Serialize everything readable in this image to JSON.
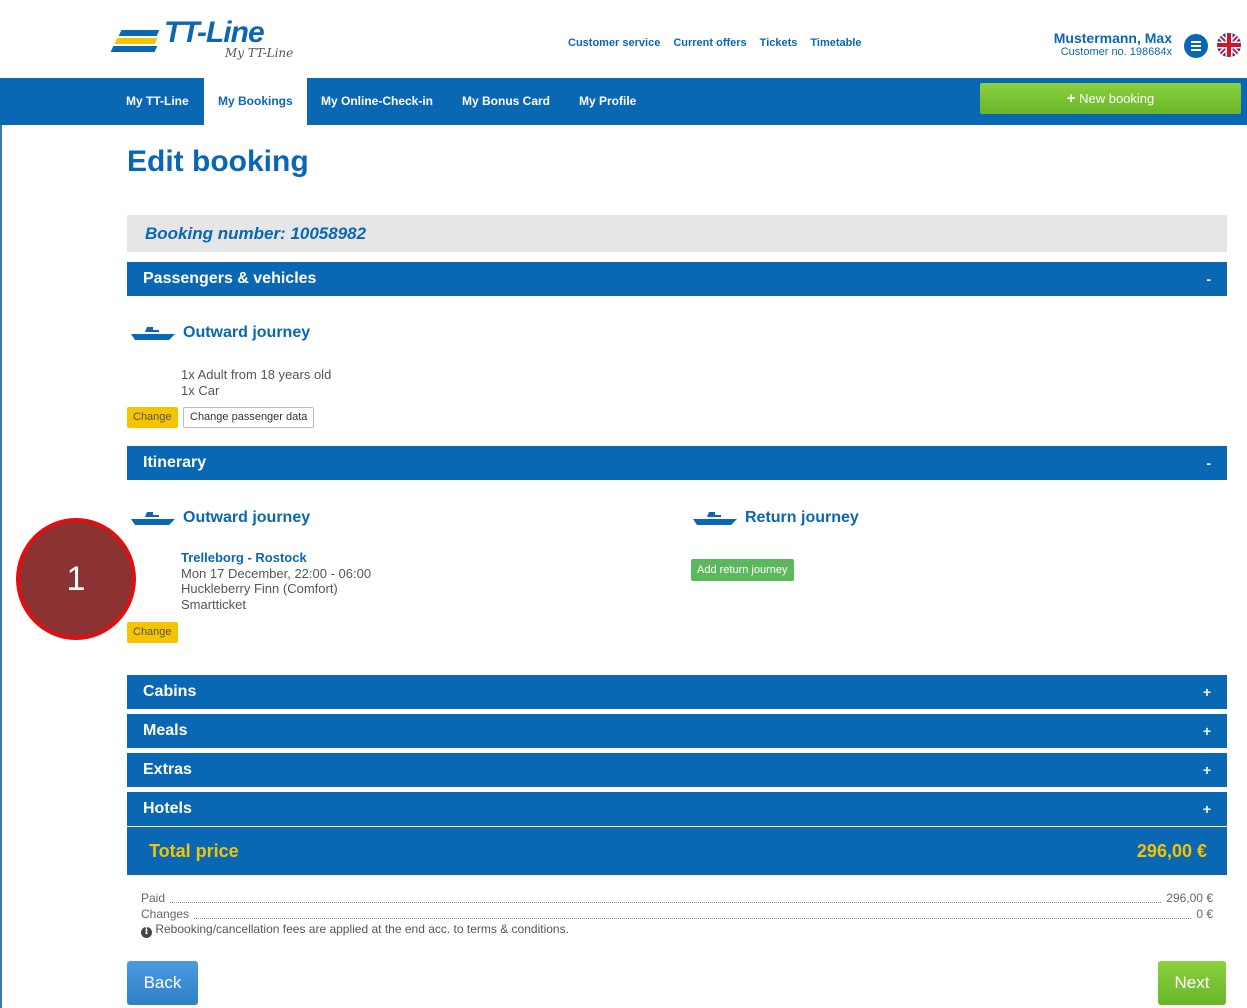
{
  "header": {
    "brand": "TT-Line",
    "brand_sub": "My TT-Line",
    "links": [
      "Customer service",
      "Current offers",
      "Tickets",
      "Timetable"
    ],
    "user_name": "Mustermann, Max",
    "customer_no": "Customer no. 198684x"
  },
  "nav": {
    "tabs": [
      "My TT-Line",
      "My Bookings",
      "My Online-Check-in",
      "My Bonus Card",
      "My Profile"
    ],
    "new_booking": "New booking"
  },
  "page": {
    "title": "Edit booking",
    "booking_number": "Booking number: 10058982"
  },
  "passengers": {
    "header": "Passengers & vehicles",
    "toggle": "-",
    "outward_title": "Outward journey",
    "items": [
      "1x Adult from 18 years old",
      "1x Car"
    ],
    "change_label": "Change",
    "change_data_label": "Change passenger data"
  },
  "itinerary": {
    "header": "Itinerary",
    "toggle": "-",
    "outward_title": "Outward journey",
    "route": "Trelleborg - Rostock",
    "datetime": "Mon 17 December, 22:00 - 06:00",
    "ship": "Huckleberry Finn (Comfort)",
    "ticket": "Smartticket",
    "change_label": "Change",
    "return_title": "Return journey",
    "add_return_label": "Add return journey"
  },
  "sections": [
    {
      "label": "Cabins",
      "toggle": "+"
    },
    {
      "label": "Meals",
      "toggle": "+"
    },
    {
      "label": "Extras",
      "toggle": "+"
    },
    {
      "label": "Hotels",
      "toggle": "+"
    }
  ],
  "total": {
    "label": "Total price",
    "amount": "296,00 €",
    "paid_label": "Paid",
    "paid_value": "296,00 €",
    "changes_label": "Changes",
    "changes_value": "0 €",
    "note": "Rebooking/cancellation fees are applied at the end acc. to terms & conditions."
  },
  "actions": {
    "back": "Back",
    "next": "Next"
  },
  "callout": {
    "number": "1"
  },
  "colors": {
    "primary": "#0a67b3",
    "accent_yellow": "#f5c400",
    "green": "#6ab52a",
    "callout": "#8b3232"
  }
}
